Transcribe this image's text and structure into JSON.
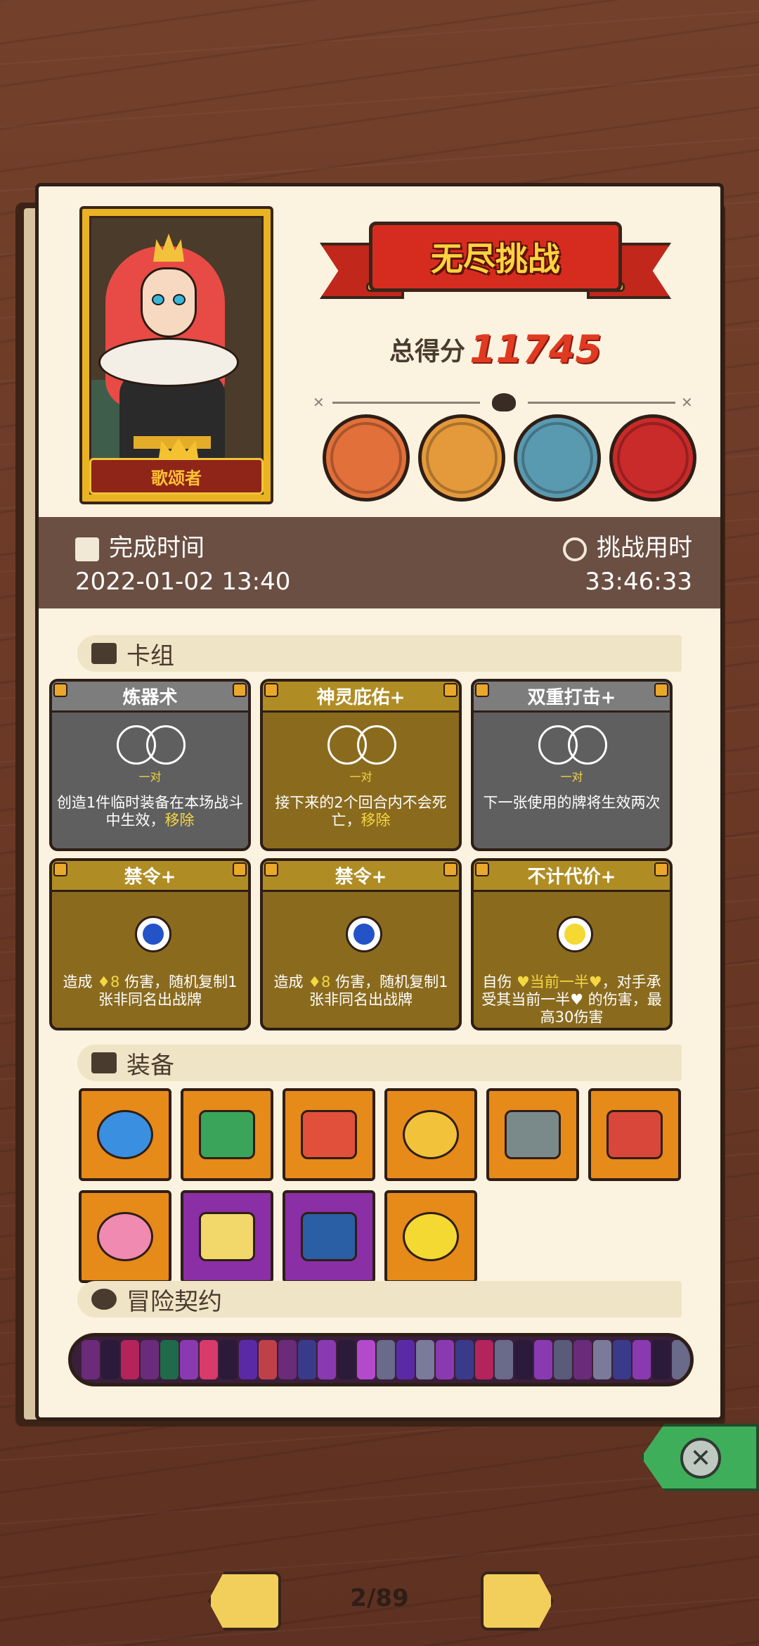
{
  "hero": {
    "name": "歌颂者"
  },
  "mode_title": "无尽挑战",
  "score": {
    "label": "总得分",
    "value": "11745"
  },
  "bosses": [
    {
      "icon": "cyclops-boss-icon",
      "color": "#e2703a"
    },
    {
      "icon": "lion-boss-icon",
      "color": "#e49a3b"
    },
    {
      "icon": "shark-boss-icon",
      "color": "#5a9ab0"
    },
    {
      "icon": "jester-boss-icon",
      "color": "#c92a2a"
    }
  ],
  "time": {
    "complete_label": "完成时间",
    "complete_value": "2022-01-02 13:40",
    "duration_label": "挑战用时",
    "duration_value": "33:46:33"
  },
  "deck": {
    "title": "卡组",
    "cards": [
      {
        "name": "炼器术",
        "style": "gray",
        "cost": "pair",
        "cost_label": "一对",
        "desc_a": "创造1件临时装备在本场战斗中生效，",
        "desc_hl": "移除",
        "desc_b": ""
      },
      {
        "name": "神灵庇佑+",
        "style": "gold",
        "cost": "pair",
        "cost_label": "一对",
        "desc_a": "接下来的2个回合内不会死亡，",
        "desc_hl": "移除",
        "desc_b": ""
      },
      {
        "name": "双重打击+",
        "style": "gray",
        "cost": "pair",
        "cost_label": "一对",
        "desc_a": "下一张使用的牌将生效两次",
        "desc_hl": "",
        "desc_b": ""
      },
      {
        "name": "禁令+",
        "style": "gold",
        "cost": "orb",
        "orb_color": "#2453c8",
        "desc_a": "造成 ",
        "desc_hl": "♦8",
        "desc_b": " 伤害，随机复制1张非同名出战牌"
      },
      {
        "name": "禁令+",
        "style": "gold",
        "cost": "orb",
        "orb_color": "#2453c8",
        "desc_a": "造成 ",
        "desc_hl": "♦8",
        "desc_b": " 伤害，随机复制1张非同名出战牌"
      },
      {
        "name": "不计代价+",
        "style": "gold",
        "cost": "orb",
        "orb_color": "#f4d932",
        "desc_a": "自伤 ",
        "desc_hl": "♥当前一半♥",
        "desc_b": "，对手承受其当前一半♥ 的伤害，最高30伤害"
      }
    ]
  },
  "equipment": {
    "title": "装备",
    "items": [
      {
        "icon": "blue-mushroom-icon",
        "bg": "orange",
        "color": "#3b8fe0"
      },
      {
        "icon": "moss-stone-icon",
        "bg": "orange",
        "color": "#3aa55a"
      },
      {
        "icon": "red-shield-icon",
        "bg": "orange",
        "color": "#e0503a"
      },
      {
        "icon": "gold-crown-icon",
        "bg": "orange",
        "color": "#f2c23a"
      },
      {
        "icon": "stone-gear-icon",
        "bg": "orange",
        "color": "#7a8a8a"
      },
      {
        "icon": "meat-leg-icon",
        "bg": "orange",
        "color": "#d9463a"
      },
      {
        "icon": "lotus-flower-icon",
        "bg": "orange",
        "color": "#f08ab0"
      },
      {
        "icon": "gold-wheel-icon",
        "bg": "purple",
        "color": "#f2d86a"
      },
      {
        "icon": "blue-armor-icon",
        "bg": "purple",
        "color": "#2a5fa6"
      },
      {
        "icon": "yellow-dice-icon",
        "bg": "orange",
        "color": "#f4d932"
      }
    ]
  },
  "contracts": {
    "title": "冒险契约",
    "colors": [
      "#6a2b7a",
      "#2b1a3a",
      "#b3245a",
      "#6a2b7a",
      "#1f6a4a",
      "#8a3ab0",
      "#d83a6a",
      "#2b1a3a",
      "#5a2aa6",
      "#c0404a",
      "#6a2b7a",
      "#3a3a8a",
      "#8a3ab0",
      "#2b1a3a",
      "#b34acc",
      "#6a6a8a",
      "#5a2aa6",
      "#7a7a9a",
      "#8a3ab0",
      "#3a3a8a",
      "#b3245a",
      "#6a6a8a",
      "#2b1a3a",
      "#8a3ab0",
      "#5a5a7a",
      "#6a2b7a",
      "#7a7a9a",
      "#3a3a8a",
      "#8a3ab0",
      "#2b1a3a",
      "#6a6a8a",
      "#5a2aa6"
    ]
  },
  "pager": {
    "text": "2/89"
  }
}
